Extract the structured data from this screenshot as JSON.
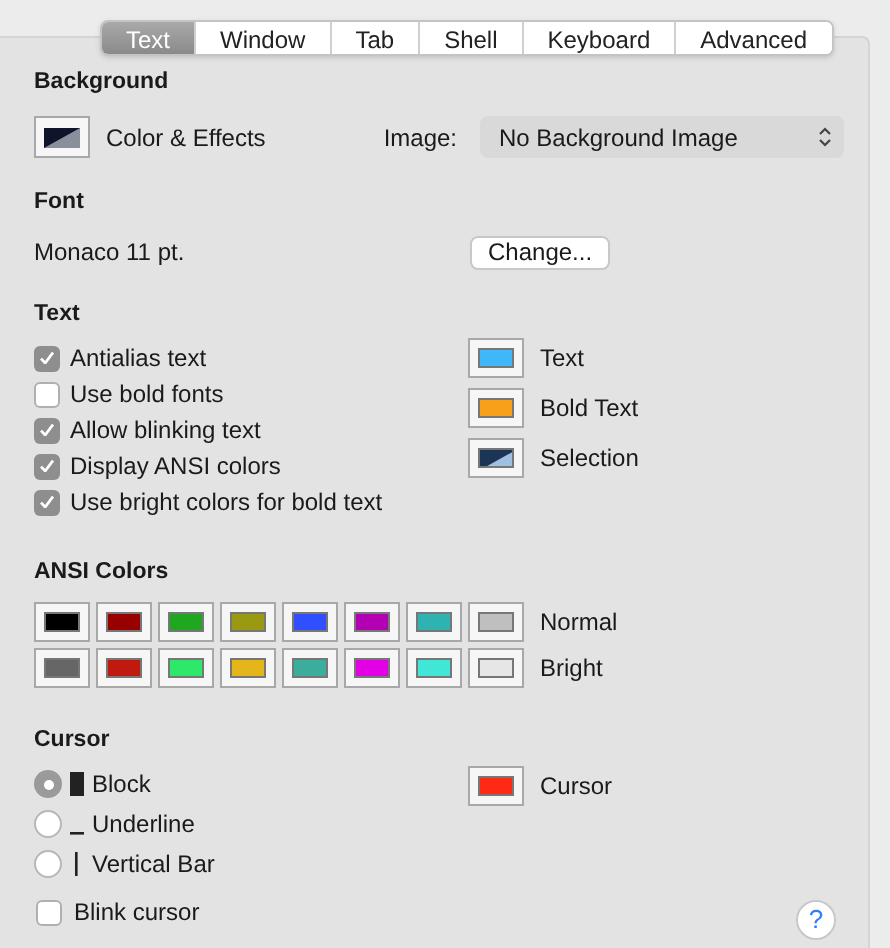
{
  "tabs": [
    {
      "label": "Text",
      "selected": true
    },
    {
      "label": "Window",
      "selected": false
    },
    {
      "label": "Tab",
      "selected": false
    },
    {
      "label": "Shell",
      "selected": false
    },
    {
      "label": "Keyboard",
      "selected": false
    },
    {
      "label": "Advanced",
      "selected": false
    }
  ],
  "background": {
    "heading": "Background",
    "button_label": "Color & Effects",
    "image_label": "Image:",
    "image_value": "No Background Image"
  },
  "font": {
    "heading": "Font",
    "value": "Monaco 11 pt.",
    "button": "Change..."
  },
  "text": {
    "heading": "Text",
    "options": [
      {
        "label": "Antialias text",
        "checked": true
      },
      {
        "label": "Use bold fonts",
        "checked": false
      },
      {
        "label": "Allow blinking text",
        "checked": true
      },
      {
        "label": "Display ANSI colors",
        "checked": true
      },
      {
        "label": "Use bright colors for bold text",
        "checked": true
      }
    ],
    "colors": [
      {
        "label": "Text",
        "color": "#3eb8f8",
        "kind": "solid"
      },
      {
        "label": "Bold Text",
        "color": "#f8a01a",
        "kind": "solid"
      },
      {
        "label": "Selection",
        "color": "#1c3557",
        "kind": "split"
      }
    ]
  },
  "ansi": {
    "heading": "ANSI Colors",
    "rows": [
      {
        "label": "Normal",
        "wells": [
          {
            "color": "#000000"
          },
          {
            "color": "#990000"
          },
          {
            "color": "#1fa81f"
          },
          {
            "color": "#999a12"
          },
          {
            "color": "#3050ff"
          },
          {
            "color": "#b200b2"
          },
          {
            "color": "#2fb2b2"
          },
          {
            "color": "#bfbfbf"
          }
        ]
      },
      {
        "label": "Bright",
        "wells": [
          {
            "color": "#666666"
          },
          {
            "color": "#c01a10"
          },
          {
            "color": "#2ee86a"
          },
          {
            "color": "#e4b61a"
          },
          {
            "color": "#3aae9a"
          },
          {
            "color": "#e400e4"
          },
          {
            "color": "#40e6d6"
          },
          {
            "color": "#e6e6e6"
          }
        ]
      }
    ]
  },
  "cursor": {
    "heading": "Cursor",
    "styles": [
      {
        "label": "Block",
        "kind": "block",
        "selected": true
      },
      {
        "label": "Underline",
        "kind": "underline",
        "selected": false
      },
      {
        "label": "Vertical Bar",
        "kind": "bar",
        "selected": false
      }
    ],
    "blink": {
      "label": "Blink cursor",
      "checked": false
    },
    "color": {
      "label": "Cursor",
      "color": "#ff2a14"
    }
  },
  "help": "?"
}
